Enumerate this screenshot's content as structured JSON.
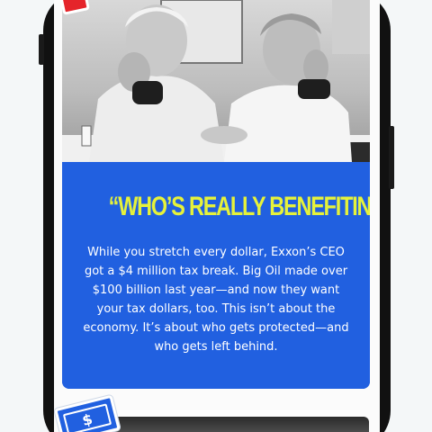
{
  "card": {
    "headline": "“WHO’S REALLY BENEFITING?”",
    "body": "While you stretch every dollar, Exxon’s CEO got a $4 million tax break. Big Oil made over $100 billion last year—and now they want your tax dollars, too. This isn’t about the economy. It’s about who gets protected—and who gets left behind.",
    "photo_icon": "worried-couple-photo"
  },
  "stickers": {
    "money_symbol": "$",
    "money_icon": "dollar-bill-icon",
    "red_icon": "red-sticker-icon"
  },
  "colors": {
    "panel_blue": "#2160e0",
    "headline_yellow": "#e6f23a",
    "sticker_red": "#e5242a"
  }
}
